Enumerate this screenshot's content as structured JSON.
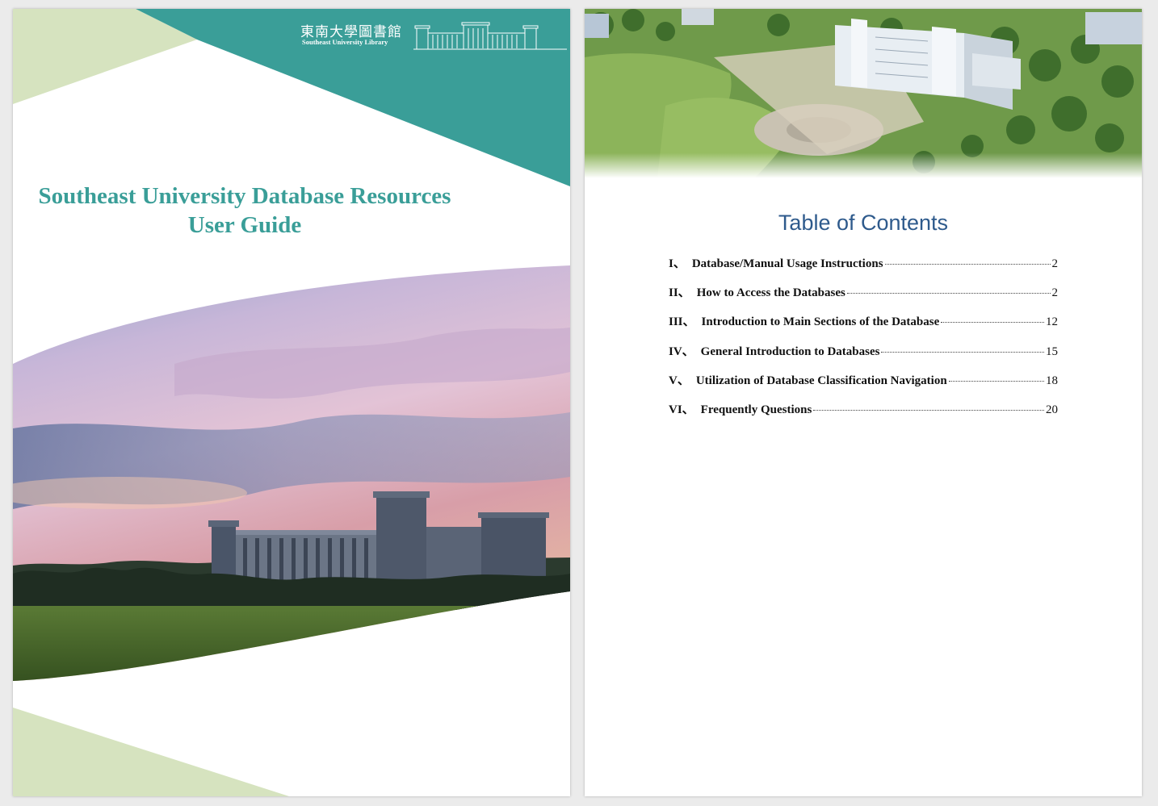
{
  "cover": {
    "logo": {
      "chinese_name": "東南大學圖書館",
      "english_name": "Southeast University Library"
    },
    "title_line1": "Southeast University Database Resources",
    "title_line2": "User Guide",
    "colors": {
      "teal": "#3a9e98",
      "light_green": "#d6e3bf",
      "title": "#3a9e98"
    }
  },
  "toc": {
    "heading": "Table of  Contents",
    "entries": [
      {
        "num": "I、",
        "title": "Database/Manual Usage Instructions",
        "page": "2"
      },
      {
        "num": "II、",
        "title": "How to Access the Databases",
        "page": "2"
      },
      {
        "num": "III、",
        "title": "Introduction to Main Sections of the Database",
        "page": "12"
      },
      {
        "num": "IV、",
        "title": "General Introduction to Databases",
        "page": "15"
      },
      {
        "num": "V、",
        "title": "Utilization of Database Classification Navigation",
        "page": "18"
      },
      {
        "num": "VI、",
        "title": "Frequently Questions",
        "page": "20"
      }
    ],
    "colors": {
      "heading": "#2e5a8c"
    }
  }
}
